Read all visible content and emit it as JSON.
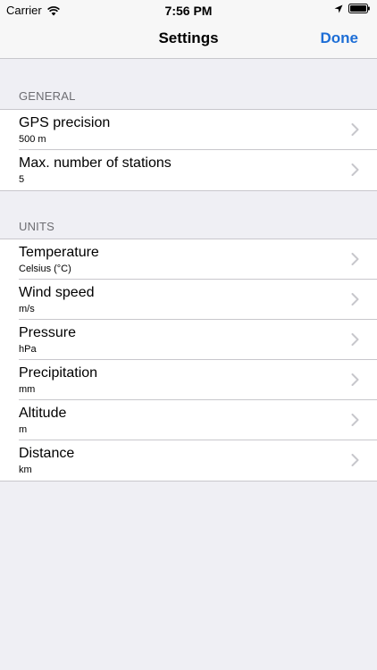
{
  "status_bar": {
    "carrier": "Carrier",
    "time": "7:56 PM"
  },
  "nav": {
    "title": "Settings",
    "done_label": "Done"
  },
  "sections": {
    "general": {
      "header": "GENERAL",
      "items": [
        {
          "title": "GPS precision",
          "value": "500 m"
        },
        {
          "title": "Max. number of stations",
          "value": "5"
        }
      ]
    },
    "units": {
      "header": "UNITS",
      "items": [
        {
          "title": "Temperature",
          "value": "Celsius (°C)"
        },
        {
          "title": "Wind speed",
          "value": "m/s"
        },
        {
          "title": "Pressure",
          "value": "hPa"
        },
        {
          "title": "Precipitation",
          "value": "mm"
        },
        {
          "title": "Altitude",
          "value": "m"
        },
        {
          "title": "Distance",
          "value": "km"
        }
      ]
    }
  },
  "colors": {
    "accent": "#1d6ed6",
    "background": "#efeff4",
    "separator": "#c8c7cc"
  },
  "icons": {
    "signal": "wifi-icon",
    "location": "location-arrow-icon",
    "battery": "battery-icon",
    "row_disclosure": "chevron-right-icon"
  }
}
